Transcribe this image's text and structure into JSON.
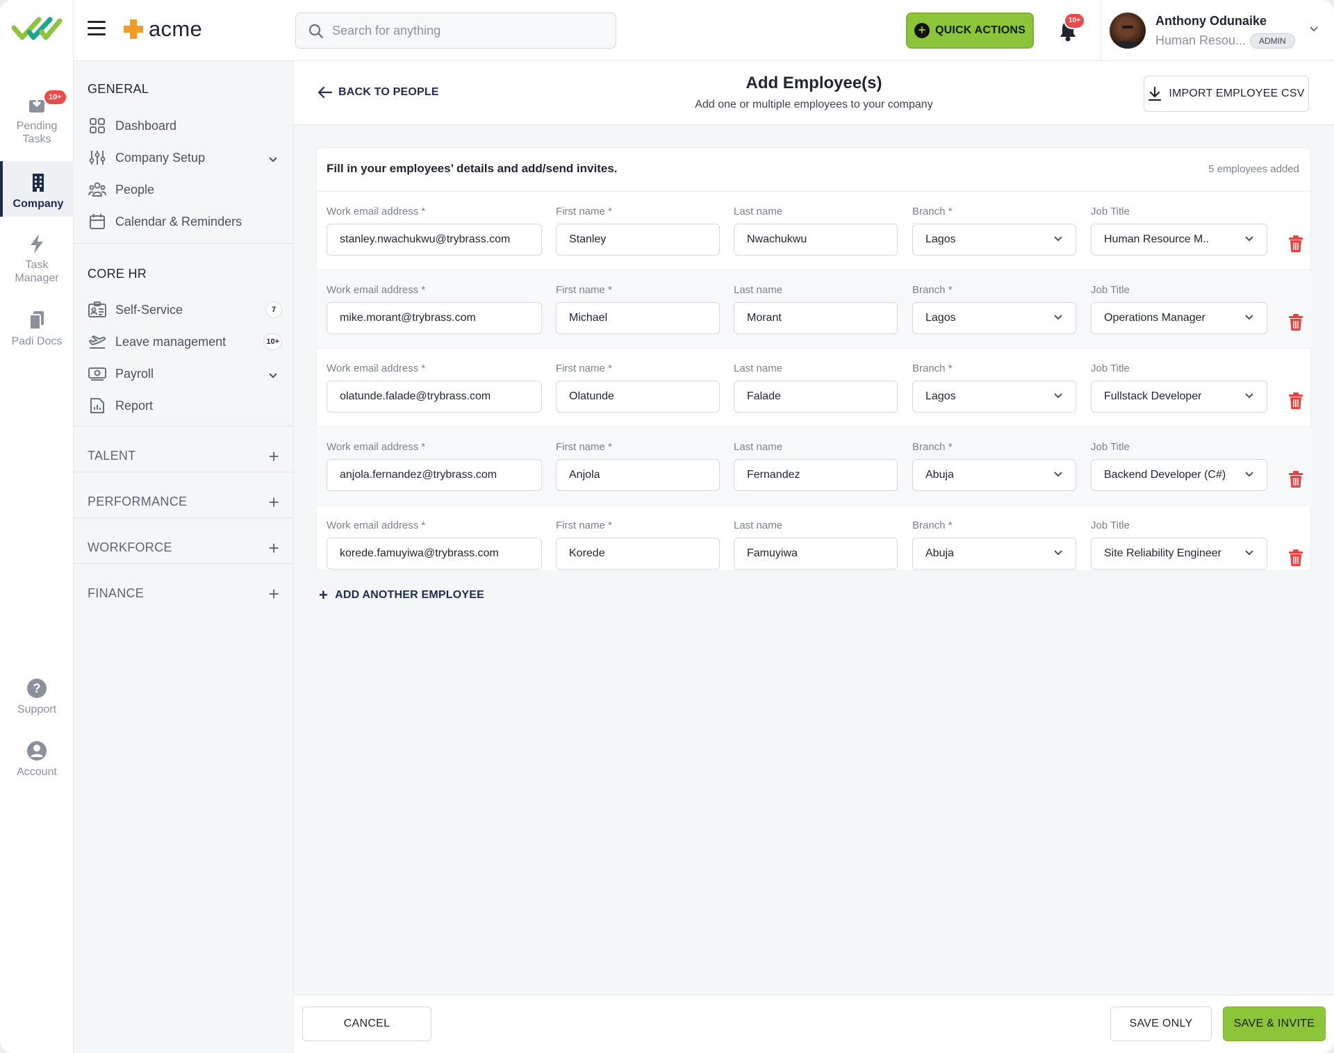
{
  "rail": {
    "items": [
      {
        "label": "Pending Tasks",
        "badge": "10+"
      },
      {
        "label": "Company"
      },
      {
        "label": "Task Manager"
      },
      {
        "label": "Padi Docs"
      },
      {
        "label": "Support"
      },
      {
        "label": "Account"
      }
    ]
  },
  "topbar": {
    "brand": "acme",
    "search_placeholder": "Search for anything",
    "quick_actions": "QUICK ACTIONS",
    "notifications_badge": "10+",
    "user": {
      "name": "Anthony Odunaike",
      "role": "Human Resou...",
      "role_badge": "ADMIN"
    }
  },
  "nav": {
    "general_heading": "GENERAL",
    "general": [
      {
        "label": "Dashboard"
      },
      {
        "label": "Company Setup"
      },
      {
        "label": "People"
      },
      {
        "label": "Calendar & Reminders"
      }
    ],
    "corehr_heading": "CORE HR",
    "corehr": [
      {
        "label": "Self-Service",
        "count": "7"
      },
      {
        "label": "Leave management",
        "count": "10+"
      },
      {
        "label": "Payroll"
      },
      {
        "label": "Report"
      }
    ],
    "collapsed": [
      {
        "label": "TALENT"
      },
      {
        "label": "PERFORMANCE"
      },
      {
        "label": "WORKFORCE"
      },
      {
        "label": "FINANCE"
      }
    ]
  },
  "page": {
    "back": "BACK TO PEOPLE",
    "title": "Add Employee(s)",
    "subtitle": "Add one or multiple employees to your company",
    "import": "IMPORT EMPLOYEE CSV"
  },
  "form": {
    "heading": "Fill in your employees’ details and add/send invites.",
    "count": "5 employees added",
    "labels": {
      "email": "Work email address *",
      "first": "First name *",
      "last": "Last name",
      "branch": "Branch *",
      "job": "Job Title"
    },
    "rows": [
      {
        "email": "stanley.nwachukwu@trybrass.com",
        "first": "Stanley",
        "last": "Nwachukwu",
        "branch": "Lagos",
        "job": "Human Resource M.."
      },
      {
        "email": "mike.morant@trybrass.com",
        "first": "Michael",
        "last": "Morant",
        "branch": "Lagos",
        "job": "Operations Manager"
      },
      {
        "email": "olatunde.falade@trybrass.com",
        "first": "Olatunde",
        "last": "Falade",
        "branch": "Lagos",
        "job": "Fullstack Developer"
      },
      {
        "email": "anjola.fernandez@trybrass.com",
        "first": "Anjola",
        "last": "Fernandez",
        "branch": "Abuja",
        "job": "Backend Developer (C#)"
      },
      {
        "email": "korede.famuyiwa@trybrass.com",
        "first": "Korede",
        "last": "Famuyiwa",
        "branch": "Abuja",
        "job": "Site Reliability Engineer"
      }
    ],
    "add_another": "ADD ANOTHER EMPLOYEE"
  },
  "footer": {
    "cancel": "CANCEL",
    "save_only": "SAVE ONLY",
    "save_invite": "SAVE & INVITE"
  },
  "colors": {
    "accent_green": "#8cc43a",
    "navy": "#1d2a52",
    "danger": "#e8413b",
    "brand_orange": "#f59a23"
  }
}
